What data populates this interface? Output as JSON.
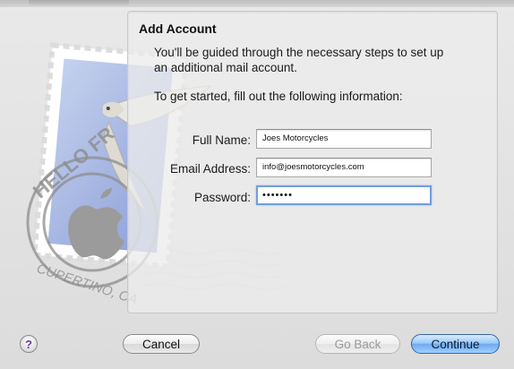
{
  "window": {
    "title": "Add Account"
  },
  "intro": {
    "line1": "You'll be guided through the necessary steps to set up",
    "line2": "an additional mail account.",
    "prompt": "To get started, fill out the following information:"
  },
  "form": {
    "full_name": {
      "label": "Full Name:",
      "value": "Joes Motorcycles"
    },
    "email": {
      "label": "Email Address:",
      "value": "info@joesmotorcycles.com"
    },
    "password": {
      "label": "Password:",
      "value": "•••••••"
    }
  },
  "buttons": {
    "help": "?",
    "cancel": "Cancel",
    "go_back": "Go Back",
    "continue": "Continue"
  },
  "artwork": {
    "stamp_text_top": "HELLO FR",
    "stamp_text_bottom": "CUPERTINO, CA",
    "icon": "mail-stamp-icon"
  },
  "colors": {
    "focus_ring": "#6f9fe0",
    "default_button": "#6eaaf0",
    "help_mark": "#6a3aa6"
  }
}
